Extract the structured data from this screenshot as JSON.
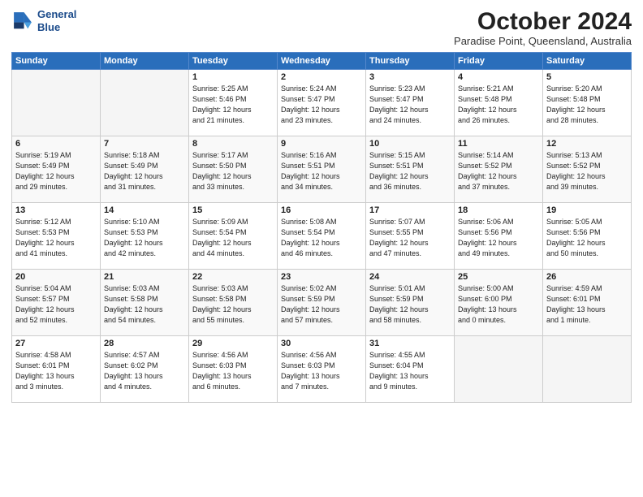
{
  "logo": {
    "line1": "General",
    "line2": "Blue"
  },
  "title": "October 2024",
  "subtitle": "Paradise Point, Queensland, Australia",
  "days_of_week": [
    "Sunday",
    "Monday",
    "Tuesday",
    "Wednesday",
    "Thursday",
    "Friday",
    "Saturday"
  ],
  "weeks": [
    [
      {
        "num": "",
        "info": ""
      },
      {
        "num": "",
        "info": ""
      },
      {
        "num": "1",
        "info": "Sunrise: 5:25 AM\nSunset: 5:46 PM\nDaylight: 12 hours\nand 21 minutes."
      },
      {
        "num": "2",
        "info": "Sunrise: 5:24 AM\nSunset: 5:47 PM\nDaylight: 12 hours\nand 23 minutes."
      },
      {
        "num": "3",
        "info": "Sunrise: 5:23 AM\nSunset: 5:47 PM\nDaylight: 12 hours\nand 24 minutes."
      },
      {
        "num": "4",
        "info": "Sunrise: 5:21 AM\nSunset: 5:48 PM\nDaylight: 12 hours\nand 26 minutes."
      },
      {
        "num": "5",
        "info": "Sunrise: 5:20 AM\nSunset: 5:48 PM\nDaylight: 12 hours\nand 28 minutes."
      }
    ],
    [
      {
        "num": "6",
        "info": "Sunrise: 5:19 AM\nSunset: 5:49 PM\nDaylight: 12 hours\nand 29 minutes."
      },
      {
        "num": "7",
        "info": "Sunrise: 5:18 AM\nSunset: 5:49 PM\nDaylight: 12 hours\nand 31 minutes."
      },
      {
        "num": "8",
        "info": "Sunrise: 5:17 AM\nSunset: 5:50 PM\nDaylight: 12 hours\nand 33 minutes."
      },
      {
        "num": "9",
        "info": "Sunrise: 5:16 AM\nSunset: 5:51 PM\nDaylight: 12 hours\nand 34 minutes."
      },
      {
        "num": "10",
        "info": "Sunrise: 5:15 AM\nSunset: 5:51 PM\nDaylight: 12 hours\nand 36 minutes."
      },
      {
        "num": "11",
        "info": "Sunrise: 5:14 AM\nSunset: 5:52 PM\nDaylight: 12 hours\nand 37 minutes."
      },
      {
        "num": "12",
        "info": "Sunrise: 5:13 AM\nSunset: 5:52 PM\nDaylight: 12 hours\nand 39 minutes."
      }
    ],
    [
      {
        "num": "13",
        "info": "Sunrise: 5:12 AM\nSunset: 5:53 PM\nDaylight: 12 hours\nand 41 minutes."
      },
      {
        "num": "14",
        "info": "Sunrise: 5:10 AM\nSunset: 5:53 PM\nDaylight: 12 hours\nand 42 minutes."
      },
      {
        "num": "15",
        "info": "Sunrise: 5:09 AM\nSunset: 5:54 PM\nDaylight: 12 hours\nand 44 minutes."
      },
      {
        "num": "16",
        "info": "Sunrise: 5:08 AM\nSunset: 5:54 PM\nDaylight: 12 hours\nand 46 minutes."
      },
      {
        "num": "17",
        "info": "Sunrise: 5:07 AM\nSunset: 5:55 PM\nDaylight: 12 hours\nand 47 minutes."
      },
      {
        "num": "18",
        "info": "Sunrise: 5:06 AM\nSunset: 5:56 PM\nDaylight: 12 hours\nand 49 minutes."
      },
      {
        "num": "19",
        "info": "Sunrise: 5:05 AM\nSunset: 5:56 PM\nDaylight: 12 hours\nand 50 minutes."
      }
    ],
    [
      {
        "num": "20",
        "info": "Sunrise: 5:04 AM\nSunset: 5:57 PM\nDaylight: 12 hours\nand 52 minutes."
      },
      {
        "num": "21",
        "info": "Sunrise: 5:03 AM\nSunset: 5:58 PM\nDaylight: 12 hours\nand 54 minutes."
      },
      {
        "num": "22",
        "info": "Sunrise: 5:03 AM\nSunset: 5:58 PM\nDaylight: 12 hours\nand 55 minutes."
      },
      {
        "num": "23",
        "info": "Sunrise: 5:02 AM\nSunset: 5:59 PM\nDaylight: 12 hours\nand 57 minutes."
      },
      {
        "num": "24",
        "info": "Sunrise: 5:01 AM\nSunset: 5:59 PM\nDaylight: 12 hours\nand 58 minutes."
      },
      {
        "num": "25",
        "info": "Sunrise: 5:00 AM\nSunset: 6:00 PM\nDaylight: 13 hours\nand 0 minutes."
      },
      {
        "num": "26",
        "info": "Sunrise: 4:59 AM\nSunset: 6:01 PM\nDaylight: 13 hours\nand 1 minute."
      }
    ],
    [
      {
        "num": "27",
        "info": "Sunrise: 4:58 AM\nSunset: 6:01 PM\nDaylight: 13 hours\nand 3 minutes."
      },
      {
        "num": "28",
        "info": "Sunrise: 4:57 AM\nSunset: 6:02 PM\nDaylight: 13 hours\nand 4 minutes."
      },
      {
        "num": "29",
        "info": "Sunrise: 4:56 AM\nSunset: 6:03 PM\nDaylight: 13 hours\nand 6 minutes."
      },
      {
        "num": "30",
        "info": "Sunrise: 4:56 AM\nSunset: 6:03 PM\nDaylight: 13 hours\nand 7 minutes."
      },
      {
        "num": "31",
        "info": "Sunrise: 4:55 AM\nSunset: 6:04 PM\nDaylight: 13 hours\nand 9 minutes."
      },
      {
        "num": "",
        "info": ""
      },
      {
        "num": "",
        "info": ""
      }
    ]
  ]
}
